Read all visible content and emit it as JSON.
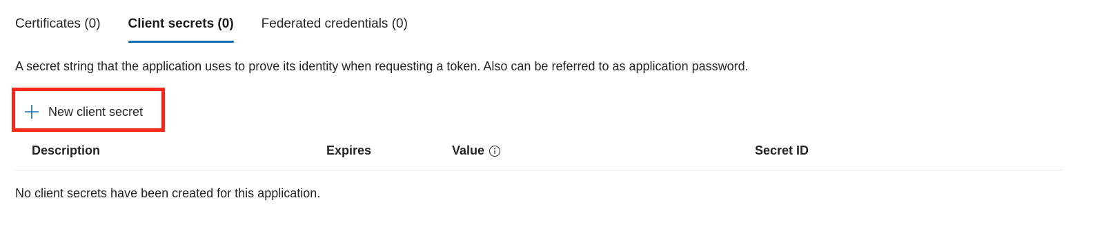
{
  "tabs": [
    {
      "label": "Certificates (0)",
      "active": false
    },
    {
      "label": "Client secrets (0)",
      "active": true
    },
    {
      "label": "Federated credentials (0)",
      "active": false
    }
  ],
  "description": "A secret string that the application uses to prove its identity when requesting a token. Also can be referred to as application password.",
  "toolbar": {
    "new_secret_label": "New client secret",
    "new_secret_icon": "plus-icon"
  },
  "table": {
    "columns": [
      "Description",
      "Expires",
      "Value",
      "Secret ID"
    ],
    "value_info_icon": "info-icon",
    "empty_message": "No client secrets have been created for this application."
  },
  "colors": {
    "accent": "#0f6cbd",
    "highlight_border": "#f52718",
    "text": "#242424",
    "divider": "#e6e6e6"
  }
}
